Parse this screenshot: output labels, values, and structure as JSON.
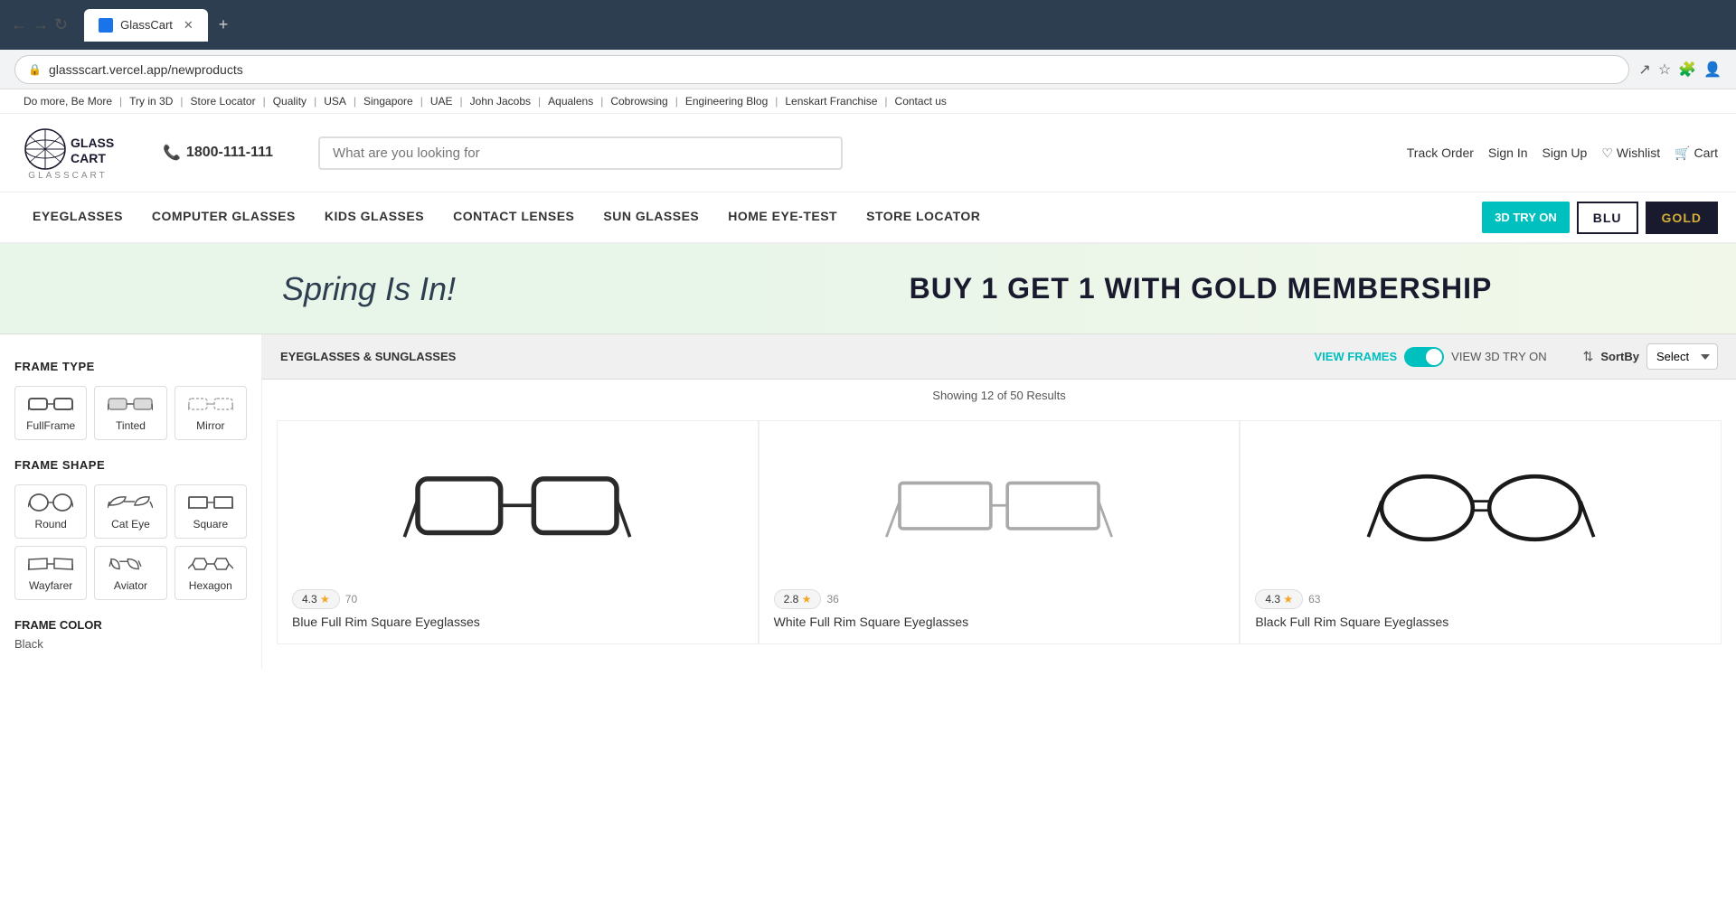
{
  "browser": {
    "tab_title": "GlassCart",
    "url": "glassscart.vercel.app/newproducts",
    "new_tab_label": "+",
    "back_label": "←",
    "forward_label": "→",
    "refresh_label": "↻"
  },
  "utility_bar": {
    "links": [
      "Do more, Be More",
      "Try in 3D",
      "Store Locator",
      "Quality",
      "USA",
      "Singapore",
      "UAE",
      "John Jacobs",
      "Aqualens",
      "Cobrowsing",
      "Engineering Blog",
      "Lenskart Franchise",
      "Contact us"
    ]
  },
  "header": {
    "logo_top": "GLASSCART",
    "logo_sub": "GLASSCART",
    "phone": "1800-111-111",
    "search_placeholder": "What are you looking for",
    "track_order": "Track Order",
    "sign_in": "Sign In",
    "sign_up": "Sign Up",
    "wishlist": "Wishlist",
    "cart": "Cart"
  },
  "nav": {
    "items": [
      "EYEGLASSES",
      "COMPUTER GLASSES",
      "KIDS GLASSES",
      "CONTACT LENSES",
      "SUN GLASSES",
      "HOME EYE-TEST",
      "STORE LOCATOR"
    ],
    "btn_3d": "3D TRY ON",
    "btn_blu": "BLU",
    "btn_gold": "GOLD"
  },
  "banner": {
    "left_text": "Spring Is In!",
    "right_text": "BUY 1 GET 1 WITH GOLD MEMBERSHIP"
  },
  "sidebar": {
    "frame_type_title": "FRAME TYPE",
    "frame_types": [
      {
        "label": "FullFrame",
        "id": "fullframe"
      },
      {
        "label": "Tinted",
        "id": "tinted"
      },
      {
        "label": "Mirror",
        "id": "mirror"
      }
    ],
    "frame_shape_title": "FRAME SHAPE",
    "frame_shapes": [
      {
        "label": "Round",
        "id": "round"
      },
      {
        "label": "Cat Eye",
        "id": "cateye"
      },
      {
        "label": "Square",
        "id": "square"
      },
      {
        "label": "Wayfarer",
        "id": "wayfarer"
      },
      {
        "label": "Aviator",
        "id": "aviator"
      },
      {
        "label": "Hexagon",
        "id": "hexagon"
      }
    ],
    "frame_color_title": "FRAME COLOR",
    "frame_color_value": "Black"
  },
  "product_area": {
    "toolbar_title": "EYEGLASSES & SUNGLASSES",
    "view_frames_label": "VIEW FRAMES",
    "view_3d_label": "VIEW 3D TRY ON",
    "sort_label": "SortBy",
    "sort_placeholder": "Select",
    "results_text": "Showing 12 of 50 Results"
  },
  "products": [
    {
      "rating": "4.3",
      "star_count": "★",
      "review_count": "70",
      "name": "Blue Full Rim Square Eyeglasses",
      "color": "#3a3a3a"
    },
    {
      "rating": "2.8",
      "star_count": "★",
      "review_count": "36",
      "name": "White Full Rim Square Eyeglasses",
      "color": "#aaaaaa"
    },
    {
      "rating": "4.3",
      "star_count": "★",
      "review_count": "63",
      "name": "Black Full Rim Square Eyeglasses",
      "color": "#222222"
    }
  ]
}
